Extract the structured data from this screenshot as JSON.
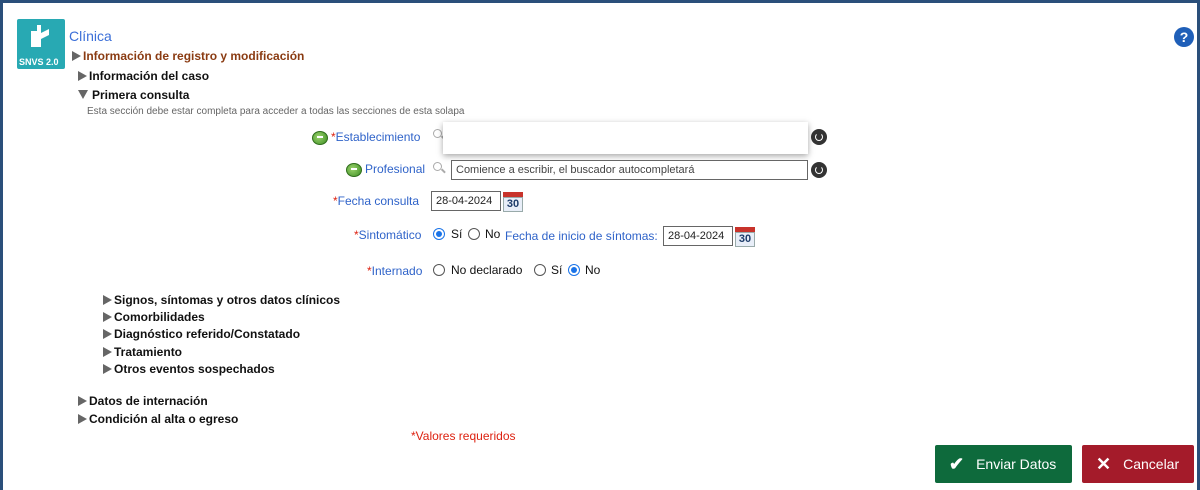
{
  "header": {
    "app_title": "Clínica",
    "logo_text": "SNVS 2.0",
    "help_icon": "question-icon"
  },
  "sections": {
    "registro": "Información de registro y modificación",
    "caso": "Información del caso",
    "primera_consulta": "Primera consulta",
    "primera_consulta_note": "Esta sección debe estar completa para acceder a todas las secciones de esta solapa",
    "signos": "Signos, síntomas y otros datos clínicos",
    "comorbilidades": "Comorbilidades",
    "diagnostico": "Diagnóstico referido/Constatado",
    "tratamiento": "Tratamiento",
    "otros_eventos": "Otros eventos sospechados",
    "internacion": "Datos de internación",
    "alta": "Condición al alta o egreso"
  },
  "form": {
    "establecimiento_label": "Establecimiento",
    "establecimiento_value": "",
    "profesional_label": "Profesional",
    "profesional_placeholder": "Comience a escribir, el buscador autocompletará",
    "fecha_consulta_label": "Fecha consulta",
    "fecha_consulta_value": "28-04-2024",
    "sintomatico_label": "Sintomático",
    "sintomatico_options": [
      "Sí",
      "No"
    ],
    "sintomatico_selected": "Sí",
    "fecha_inicio_label": "Fecha de inicio de síntomas:",
    "fecha_inicio_value": "28-04-2024",
    "internado_label": "Internado",
    "internado_options": [
      "No declarado",
      "Sí",
      "No"
    ],
    "internado_selected": "No",
    "required_mark": "*",
    "calendar_day": "30"
  },
  "footer": {
    "required_note": "*Valores requeridos",
    "send_label": "Enviar Datos",
    "cancel_label": "Cancelar"
  },
  "colors": {
    "accent_blue": "#2f63c9",
    "send_green": "#0e6a3c",
    "cancel_red": "#a41b2a",
    "required_red": "#d21"
  }
}
